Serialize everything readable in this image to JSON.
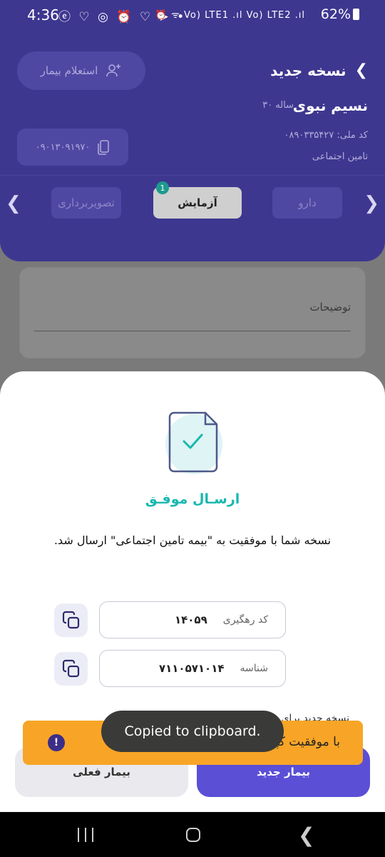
{
  "status_bar": {
    "time": "4:36",
    "notification_icons": "ⓔ ♡ ◎ ⏰ ♡ ➤ •",
    "system_icons": "⏰ ᯤ Vo) LTE1 .ıl Vo) LTE2 .ıl",
    "battery": "62%"
  },
  "header": {
    "title": "نسخه جدید",
    "inquiry_button": "استعلام بیمار",
    "patient_name": "نسیم نبوی",
    "patient_age": "۳۰ ساله",
    "national_id": "کد ملی: ۰۸۹۰۳۳۵۴۲۷",
    "insurance": "تامین اجتماعی",
    "phone": "۰۹۰۱۳۰۹۱۹۷۰",
    "tabs": [
      {
        "label": "دارو",
        "active": false
      },
      {
        "label": "آزمایش",
        "active": true,
        "badge": "1"
      },
      {
        "label": "تصویربرداری",
        "active": false
      }
    ]
  },
  "notes": {
    "label": "توضیحات"
  },
  "sheet": {
    "title": "ارسـال موفـق",
    "message": "نسخه شما با موفقیت به \"بیمه تامین اجتماعی\" ارسال شد.",
    "tracking_label": "کد رهگیری",
    "tracking_value": "۱۴۰۵۹",
    "id_label": "شناسه",
    "id_value": "۷۱۱۰۵۷۱۰۱۴",
    "behind_text": "نسخه جدید برای",
    "new_patient_button": "بیمار جدید",
    "current_patient_button": "بیمار فعلی"
  },
  "snackbar": {
    "text": "با موفقیت کپی شد",
    "icon": "!"
  },
  "toast": {
    "text": "Copied to clipboard."
  },
  "colors": {
    "header_bg": "#3e3790",
    "accent": "#5b4fd6",
    "success": "#19b8b0",
    "snackbar": "#f8a527"
  }
}
